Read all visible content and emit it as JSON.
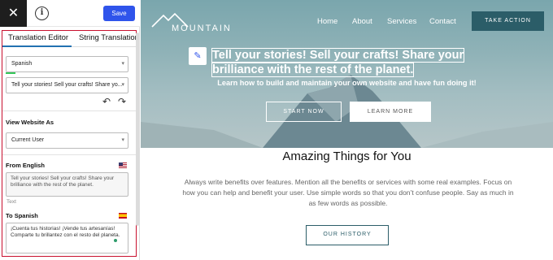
{
  "editor": {
    "close_icon": "close-icon",
    "info_icon": "info-icon",
    "save_label": "Save",
    "tabs": [
      {
        "label": "Translation Editor",
        "active": true
      },
      {
        "label": "String Translation",
        "active": false
      }
    ],
    "language_select": {
      "value": "Spanish"
    },
    "string_select": {
      "value": "Tell your stories! Sell your crafts! Share yo..."
    },
    "undo_icon": "undo-icon",
    "redo_icon": "redo-icon",
    "view_as": {
      "label": "View Website As",
      "value": "Current User"
    },
    "from": {
      "label": "From English",
      "flag": "us-flag-icon",
      "text": "Tell your stories! Sell your crafts! Share your brilliance with the rest of the planet.",
      "type_label": "Text"
    },
    "to": {
      "label": "To Spanish",
      "flag": "spain-flag-icon",
      "text": "¡Cuenta tus historias! ¡Vende tus artesanías! Comparte tu brillantez con el resto del planeta."
    },
    "accent_color": "#2f54eb",
    "highlight_color": "#c8102e"
  },
  "site": {
    "logo_text": "MOUNTAIN",
    "nav": [
      "Home",
      "About",
      "Services",
      "Contact"
    ],
    "cta_label": "TAKE ACTION",
    "headline": [
      "Tell your stories! Sell your crafts! Share your",
      "brilliance with the rest of the planet."
    ],
    "subheadline": "Learn how to build and maintain your own website and have fun doing it!",
    "buttons": {
      "start": "START NOW",
      "learn": "LEARN MORE"
    },
    "section_title": "Amazing Things for You",
    "section_body": "Always write benefits over features. Mention all the benefits or services with some real examples. Focus on how you can help and benefit your user. Use simple words so that you don’t confuse people. Say as much in as few words as possible.",
    "history_button": "OUR HISTORY",
    "brand_color": "#2b5d68"
  }
}
